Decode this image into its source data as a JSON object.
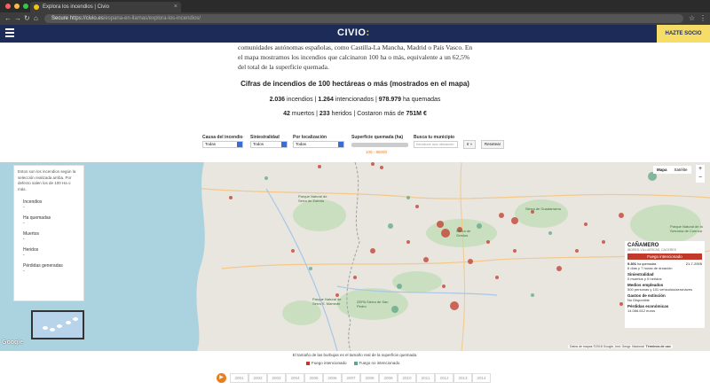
{
  "browser": {
    "tab_title": "Explora los incendios | Civio",
    "url_secure": "Secure",
    "url_host": "https://civio.es",
    "url_path": "/espana-en-llamas/explora-los-incendios/"
  },
  "header": {
    "logo": "CIVIO",
    "cta": "HAZTE SOCIO"
  },
  "article": {
    "text": "comunidades autónomas españolas, como Castilla-La Mancha, Madrid o País Vasco. En el mapa mostramos los incendios que calcinaron 100 ha o más, equivalente a un 62,5% del total de la superficie quemada."
  },
  "stats": {
    "title": "Cifras de incendios de 100 hectáreas o más (mostrados en el mapa)",
    "incendios_n": "2.036",
    "incendios_l": "incendios",
    "intencionados_n": "1.264",
    "intencionados_l": "intencionados",
    "ha_n": "978.979",
    "ha_l": "ha quemadas",
    "muertos_n": "42",
    "muertos_l": "muertos",
    "heridos_n": "233",
    "heridos_l": "heridos",
    "coste_l": "Costaron más de",
    "coste_n": "751M €"
  },
  "filters": {
    "causa_label": "Causa del incendio",
    "causa_value": "Todas",
    "sini_label": "Siniestralidad",
    "sini_value": "Todos",
    "loc_label": "Por localización",
    "loc_value": "Todas",
    "sup_label": "Superficie quemada (ha)",
    "sup_range": "100 - 86000",
    "mun_label": "Busca tu municipio",
    "mun_placeholder": "Introduce una ubicación",
    "go_btn": "Ir »",
    "reset_btn": "Resetear"
  },
  "panel": {
    "intro": "Estos son los incendios según la selección realizada arriba. Por defecto salen los de 100 Ha o más.",
    "items": [
      {
        "label": "Incendios",
        "value": "-"
      },
      {
        "label": "Ha quemadas",
        "value": "-"
      },
      {
        "label": "Muertos",
        "value": "-"
      },
      {
        "label": "Heridos",
        "value": "-"
      },
      {
        "label": "Pérdidas generadas",
        "value": "-"
      }
    ]
  },
  "map": {
    "type_map": "Mapa",
    "type_sat": "Satélite",
    "zoom_in": "+",
    "zoom_out": "−",
    "google": "Google",
    "attribution": "Datos de mapas ©2018 Google, Inst. Geogr. Nacional",
    "terms": "Términos de uso",
    "parks": [
      "Parque Natural de Serra de Estrela",
      "Sierra de Gredos",
      "Sierra de Guadarrama",
      "Parque Natural de Serra S. Mamede",
      "ZEPA Sierra de San Pedro",
      "Parque Natural de la Serranía de Cuenca"
    ],
    "colors": {
      "intencionado": "#c0392b",
      "no_intencionado": "#5fa58a"
    }
  },
  "info": {
    "title": "CAÑAMERO",
    "subtitle": "IBORES-VILLUERCAS, CACERES",
    "badge": "Fuego intencionado",
    "ha": "9.301",
    "ha_unit": "ha quemadas",
    "date": "21-7-2005",
    "duration": "6 días y 7 horas de duración",
    "sini_h": "Siniestralidad",
    "sini_v": "0 muertos y 0 heridos",
    "medios_h": "Medios empleados",
    "medios_v": "500 personas y 101 vehículos/aeronaves",
    "gastos_h": "Gastos de extinción",
    "gastos_v": "No Disponible",
    "perdidas_h": "Pérdidas económicas",
    "perdidas_v": "14.066.612 euros"
  },
  "legend": {
    "note": "El tamaño de las burbujas es el tamaño real de la superficie quemada.",
    "intencionado": "Fuego intencionado",
    "no_intencionado": "Fuego no intencionado"
  },
  "timeline": {
    "years": [
      "2001",
      "2002",
      "2003",
      "2004",
      "2005",
      "2006",
      "2007",
      "2008",
      "2009",
      "2010",
      "2011",
      "2012",
      "2013",
      "2014"
    ]
  }
}
